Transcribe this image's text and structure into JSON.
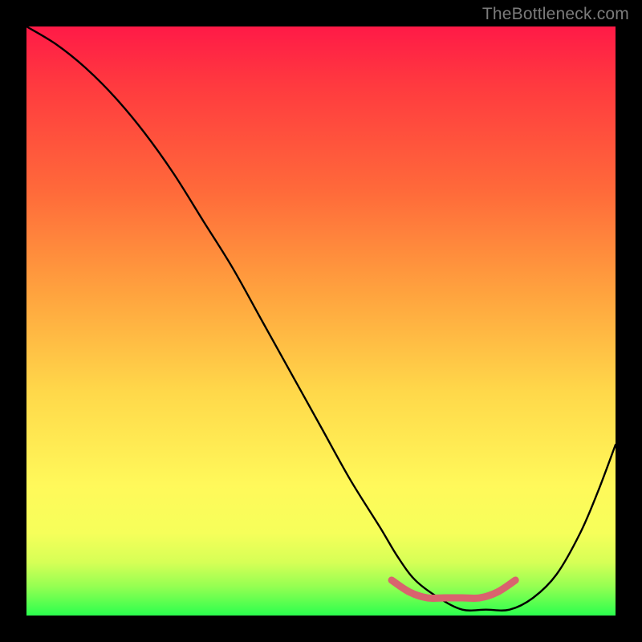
{
  "watermark": "TheBottleneck.com",
  "chart_data": {
    "type": "line",
    "title": "",
    "xlabel": "",
    "ylabel": "",
    "xlim": [
      0,
      100
    ],
    "ylim": [
      0,
      100
    ],
    "series": [
      {
        "name": "bottleneck-curve",
        "color": "#000000",
        "x": [
          0,
          5,
          10,
          15,
          20,
          25,
          30,
          35,
          40,
          45,
          50,
          55,
          60,
          63,
          66,
          70,
          74,
          78,
          82,
          86,
          90,
          94,
          97,
          100
        ],
        "values": [
          100,
          97,
          93,
          88,
          82,
          75,
          67,
          59,
          50,
          41,
          32,
          23,
          15,
          10,
          6,
          3,
          1,
          1,
          1,
          3,
          7,
          14,
          21,
          29
        ]
      },
      {
        "name": "optimal-range-marker",
        "color": "#d9636e",
        "x": [
          62,
          65,
          68,
          71,
          74,
          77,
          80,
          83
        ],
        "values": [
          6,
          4,
          3,
          3,
          3,
          3,
          4,
          6
        ]
      }
    ],
    "annotations": []
  }
}
